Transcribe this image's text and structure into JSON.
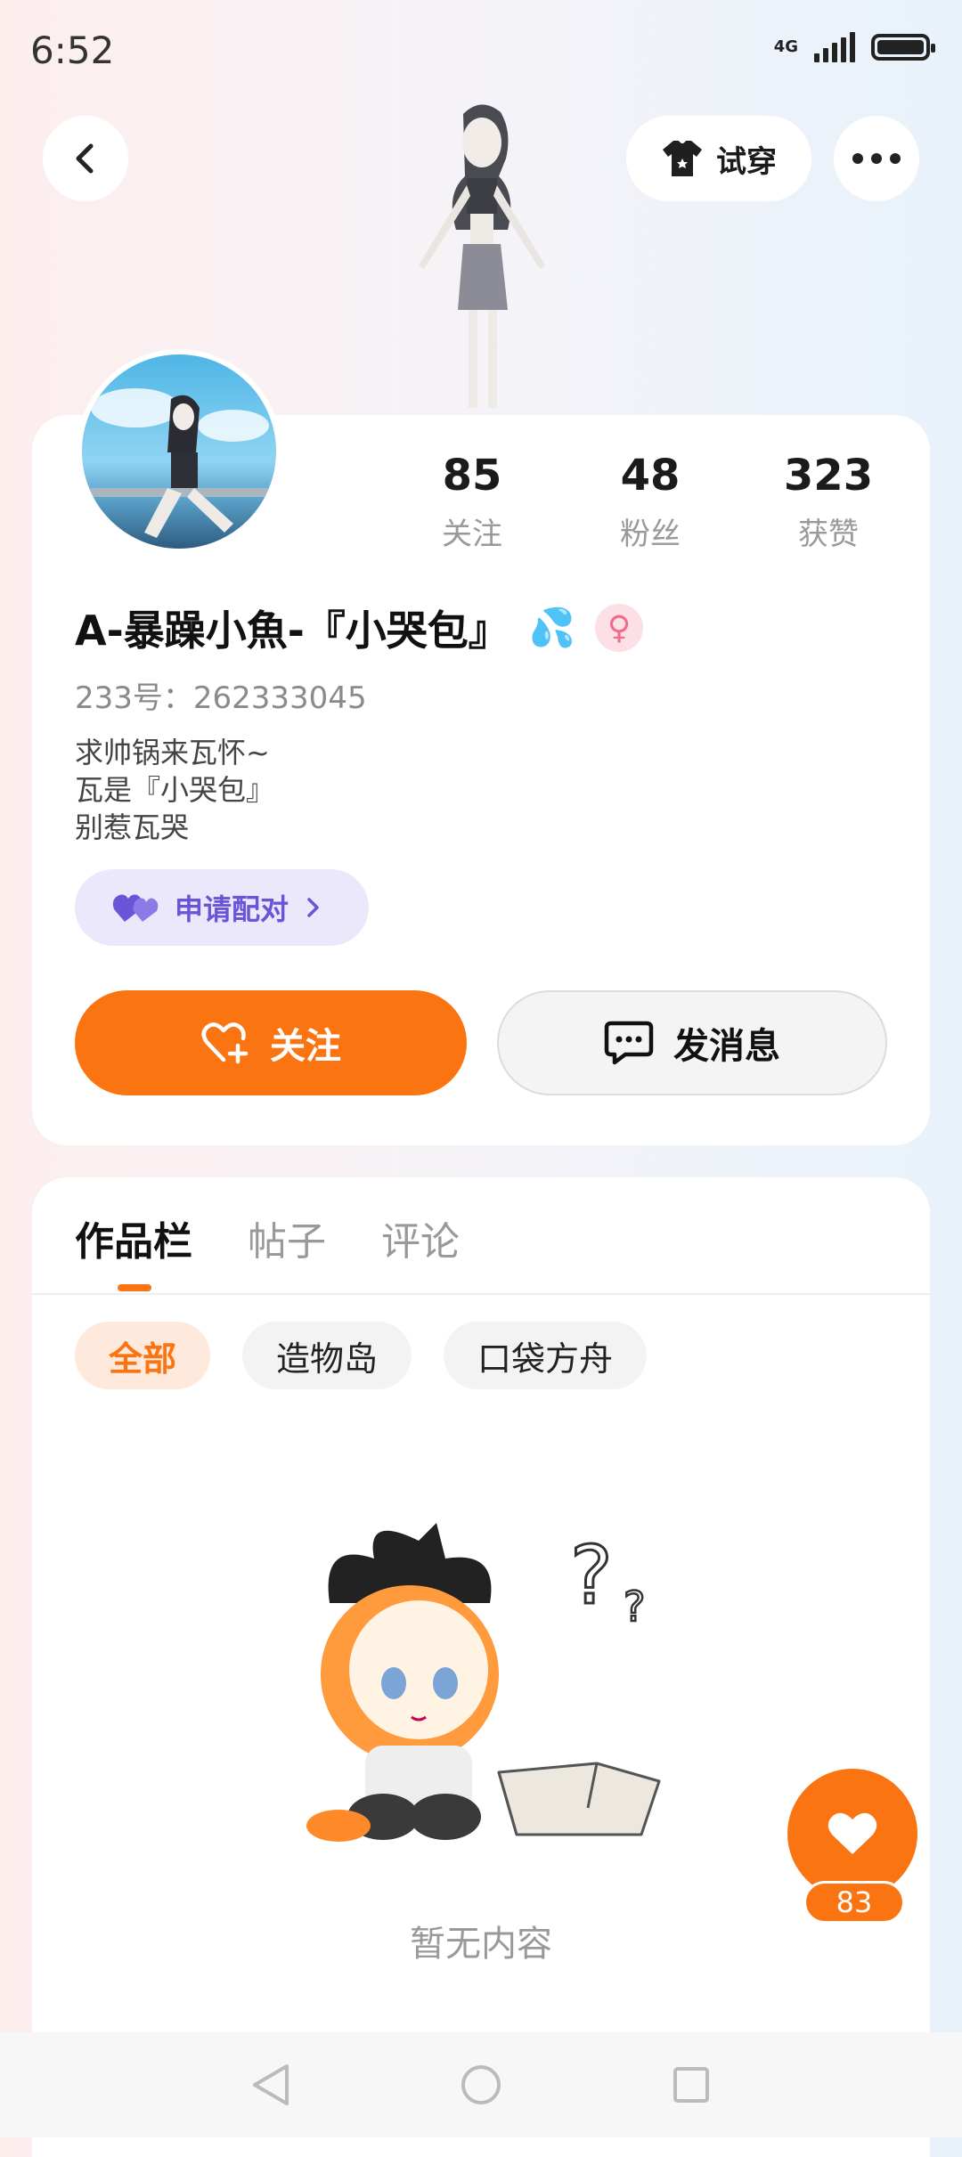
{
  "status_bar": {
    "time": "6:52",
    "network": "4G"
  },
  "header": {
    "try_on_label": "试穿"
  },
  "profile": {
    "stats": [
      {
        "value": "85",
        "label": "关注"
      },
      {
        "value": "48",
        "label": "粉丝"
      },
      {
        "value": "323",
        "label": "获赞"
      }
    ],
    "name": "A-暴躁小魚-『小哭包』",
    "name_emoji": "💦",
    "gender_symbol": "♀",
    "uid": "233号：262333045",
    "bio": [
      "求帅锅来瓦怀~",
      "瓦是『小哭包』",
      "别惹瓦哭"
    ],
    "pair_label": "申请配对",
    "follow_label": "关注",
    "message_label": "发消息"
  },
  "tabs": [
    "作品栏",
    "帖子",
    "评论"
  ],
  "filter_chips": [
    "全部",
    "造物岛",
    "口袋方舟"
  ],
  "empty_text": "暂无内容",
  "like_count": "83",
  "colors": {
    "accent": "#fb7412",
    "pair": "#6a55d8"
  }
}
